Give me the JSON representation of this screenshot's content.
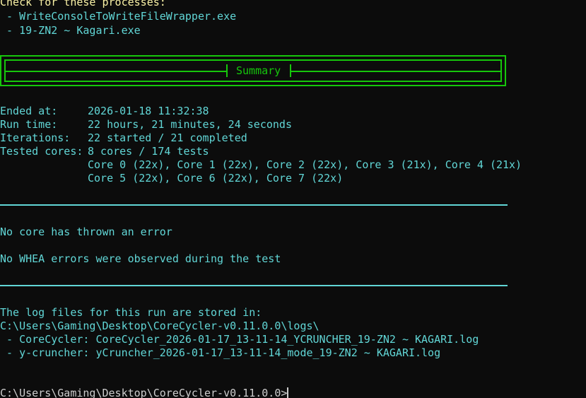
{
  "header": {
    "check_label": "Check for these processes:",
    "processes": [
      " - WriteConsoleToWriteFileWrapper.exe",
      " - 19-ZN2 ~ Kagari.exe"
    ]
  },
  "summary": {
    "title": "Summary"
  },
  "stats": {
    "ended_label": "Ended at:",
    "ended_value": "2026-01-18 11:32:38",
    "runtime_label": "Run time:",
    "runtime_value": "22 hours, 21 minutes, 24 seconds",
    "iterations_label": "Iterations:",
    "iterations_value": "22 started / 21 completed",
    "cores_label": "Tested cores:",
    "cores_value": "8 cores / 174 tests",
    "cores_detail_1": "Core 0 (22x), Core 1 (22x), Core 2 (22x), Core 3 (21x), Core 4 (21x)",
    "cores_detail_2": "Core 5 (22x), Core 6 (22x), Core 7 (22x)"
  },
  "results": {
    "core_error": "No core has thrown an error",
    "whea_error": "No WHEA errors were observed during the test"
  },
  "logs": {
    "intro": "The log files for this run are stored in:",
    "path": "C:\\Users\\Gaming\\Desktop\\CoreCycler-v0.11.0.0\\logs\\",
    "corecycler": " - CoreCycler: CoreCycler_2026-01-17_13-11-14_YCRUNCHER_19-ZN2 ~ KAGARI.log",
    "ycruncher": " - y-cruncher: yCruncher_2026-01-17_13-11-14_mode_19-ZN2 ~ KAGARI.log"
  },
  "prompt": {
    "text": "C:\\Users\\Gaming\\Desktop\\CoreCycler-v0.11.0.0>"
  },
  "colors": {
    "background": "#0c0c0c",
    "cyan": "#61d6d6",
    "green": "#16c60c",
    "yellow": "#f9f1a5"
  }
}
